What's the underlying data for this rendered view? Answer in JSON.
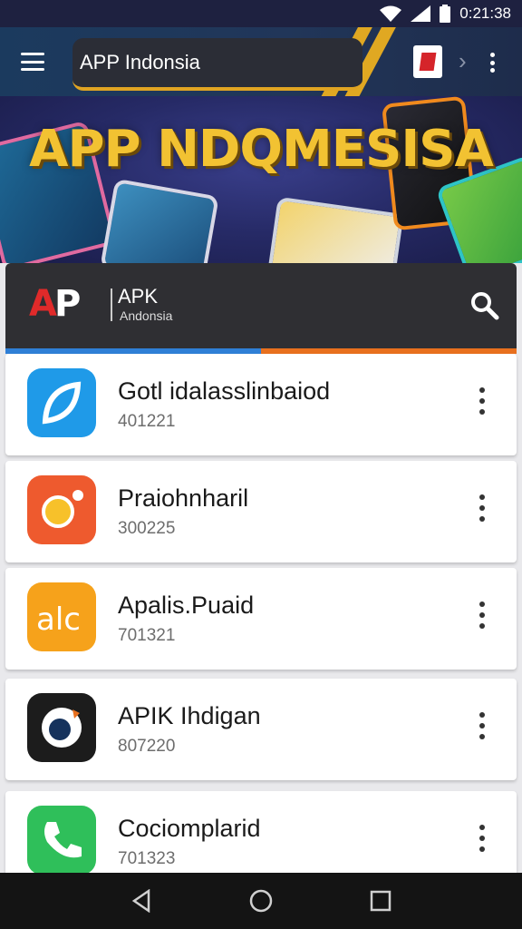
{
  "status_bar": {
    "time": "0:21:38"
  },
  "app_bar": {
    "title": "APP Indonsia"
  },
  "banner": {
    "headline": "APP NDQMESISA"
  },
  "header": {
    "logo_text": "AP",
    "brand_title": "APK",
    "brand_subtitle": "Andonsia"
  },
  "apps": [
    {
      "name": "Gotl idalasslinbaiod",
      "sub": "401221",
      "icon": "blue-leaf-icon",
      "color": "#1f9ae8"
    },
    {
      "name": "Praiohnharil",
      "sub": "300225",
      "icon": "orange-sun-icon",
      "color": "#ee5a2e"
    },
    {
      "name": "Apalis.Puaid",
      "sub": "701321",
      "icon": "alc-icon",
      "color": "#f6a21b"
    },
    {
      "name": "APIK Ihdigan",
      "sub": "807220",
      "icon": "dark-chat-icon",
      "color": "#1c1c1c"
    },
    {
      "name": "Cociomplarid",
      "sub": "701323",
      "icon": "phone-call-icon",
      "color": "#2fbf5a"
    }
  ],
  "colors": {
    "accent_gold": "#e1a422",
    "accent_blue": "#2f7fd6",
    "accent_orange": "#e8701e"
  }
}
